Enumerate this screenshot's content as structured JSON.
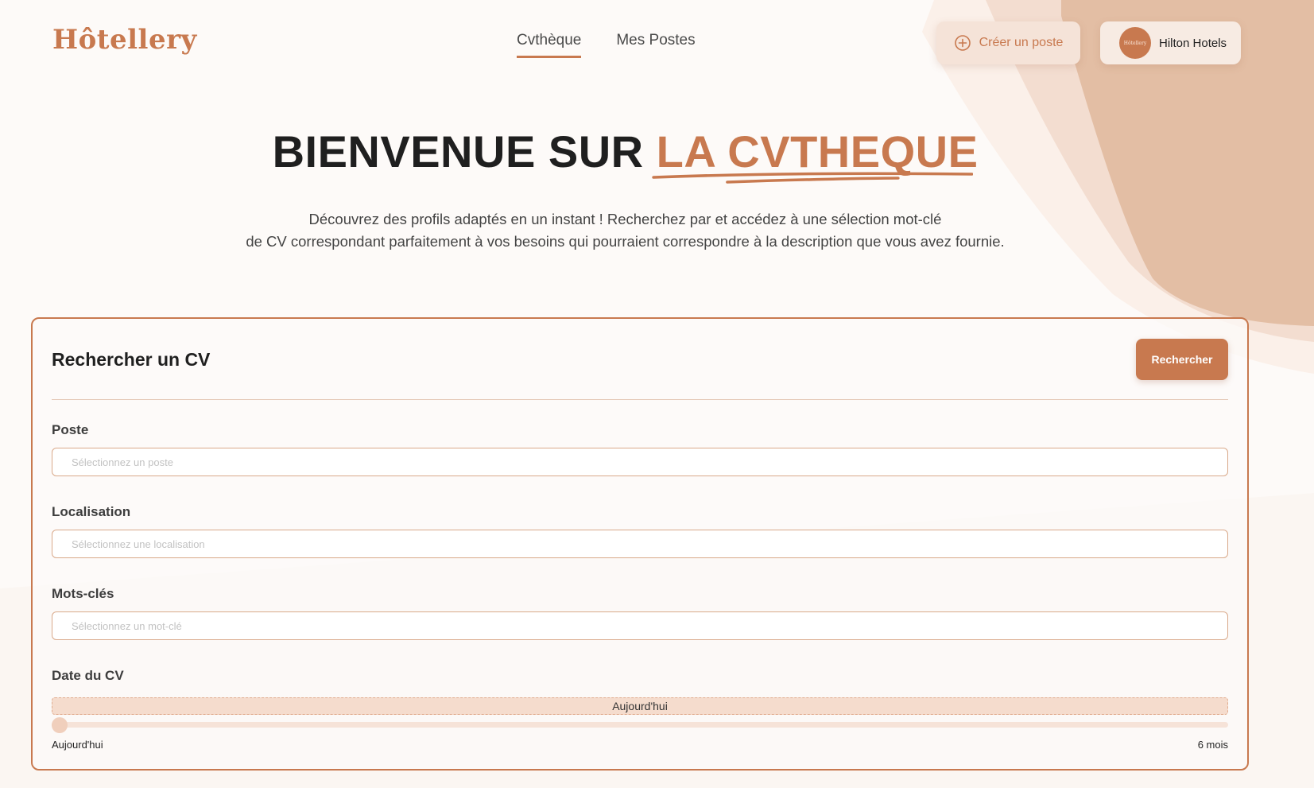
{
  "brand": {
    "logo_text": "Hôtellery",
    "accent_color": "#c8794f"
  },
  "nav": {
    "items": [
      {
        "label": "Cvthèque",
        "active": true
      },
      {
        "label": "Mes Postes",
        "active": false
      }
    ]
  },
  "header": {
    "create_button": {
      "label": "Créer un poste",
      "icon": "plus-circle-icon"
    },
    "account": {
      "name": "Hilton Hotels",
      "avatar_text": "Hôtellery"
    }
  },
  "hero": {
    "title_plain": "BIENVENUE SUR",
    "title_accent": "LA CVTHEQUE",
    "subtitle_line1": "Découvrez des profils adaptés en un instant ! Recherchez par et accédez à une sélection mot-clé",
    "subtitle_line2": "de CV correspondant parfaitement à vos besoins qui pourraient correspondre à la description que vous avez fournie."
  },
  "search": {
    "title": "Rechercher un CV",
    "button_label": "Rechercher",
    "fields": [
      {
        "label": "Poste",
        "value": "",
        "placeholder": "Sélectionnez un poste"
      },
      {
        "label": "Localisation",
        "value": "",
        "placeholder": "Sélectionnez une localisation"
      },
      {
        "label": "Mots-clés",
        "value": "",
        "placeholder": "Sélectionnez un mot-clé"
      }
    ],
    "date": {
      "label": "Date du CV",
      "current_label": "Aujourd'hui",
      "min_label": "Aujourd'hui",
      "max_label": "6 mois",
      "value_fraction": 0.0
    }
  }
}
